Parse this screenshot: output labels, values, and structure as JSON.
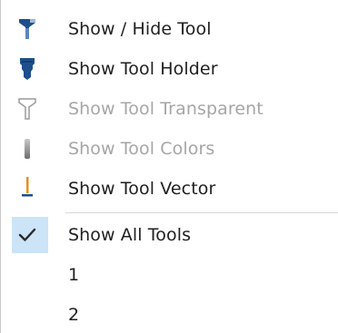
{
  "menu": {
    "items": [
      {
        "label": "Show / Hide Tool",
        "icon": "tool-icon",
        "enabled": true
      },
      {
        "label": "Show Tool Holder",
        "icon": "tool-holder-icon",
        "enabled": true
      },
      {
        "label": "Show Tool Transparent",
        "icon": "tool-transparent-icon",
        "enabled": false
      },
      {
        "label": "Show Tool Colors",
        "icon": "tool-colors-icon",
        "enabled": false
      },
      {
        "label": "Show Tool Vector",
        "icon": "tool-vector-icon",
        "enabled": true
      },
      {
        "label": "Show All Tools",
        "icon": "checkmark-icon",
        "enabled": true,
        "checked": true
      },
      {
        "label": "1",
        "enabled": true
      },
      {
        "label": "2",
        "enabled": true
      }
    ]
  },
  "colors": {
    "accent_blue": "#1c4f8c",
    "vector_orange": "#e8901a",
    "check_highlight": "#cce4f7",
    "disabled_text": "#a6a6a6"
  }
}
